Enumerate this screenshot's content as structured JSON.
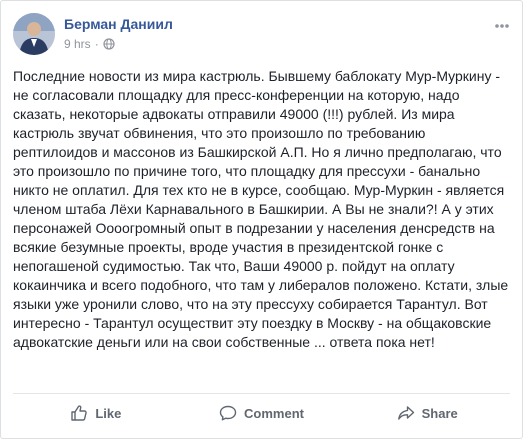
{
  "post": {
    "author": "Берман Даниил",
    "time": "9 hrs",
    "audience_icon": "public-globe-icon",
    "menu_icon": "more-options-icon",
    "text": "Последние новости из мира кастрюль. Бывшему баблокату Мур-Муркину - не согласовали площадку для пресс-конференции на которую, надо сказать, некоторые адвокаты отправили 49000 (!!!) рублей. Из мира кастрюль звучат обвинения, что это произошло по требованию рептилоидов и массонов из Башкирской А.П. Но я лично предполагаю, что это произошло по причине того, что площадку для прессухи - банально никто не оплатил. Для тех кто не в курсе, сообщаю. Мур-Муркин - является членом штаба Лёхи Карнавального в Башкирии. А Вы не знали?! А у этих персонажей Оооогромный опыт в подрезании у населения денсредств на всякие безумные проекты, вроде участия в президентской гонке с непогашеной судимостью. Так что, Ваши 49000 р. пойдут на оплату кокаинчика и всего подобного, что там у либералов положено. Кстати, злые языки уже уронили слово, что на эту прессуху собирается Тарантул. Вот интересно - Тарантул осуществит эту поездку в Москву - на общаковские адвокатские деньги или на свои собственные ... ответа пока нет!"
  },
  "actions": {
    "like_label": "Like",
    "comment_label": "Comment",
    "share_label": "Share"
  },
  "colors": {
    "author_link": "#365899",
    "meta_gray": "#90949c",
    "action_gray": "#606770",
    "text": "#1d2129"
  }
}
